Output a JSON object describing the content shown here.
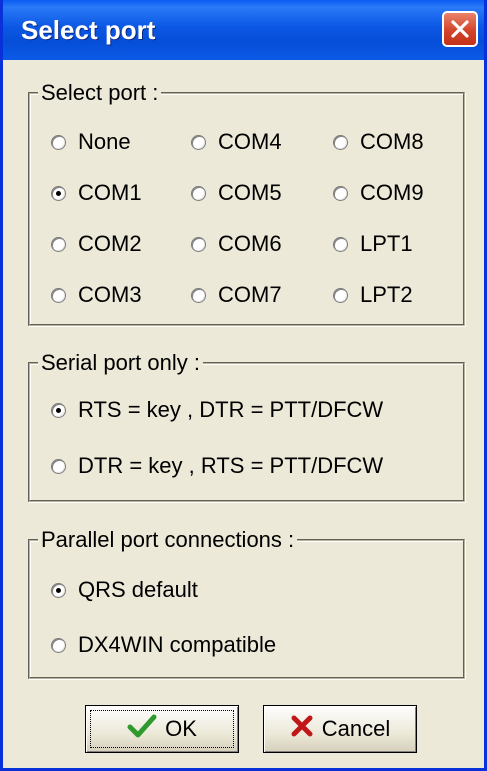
{
  "window": {
    "title": "Select port"
  },
  "port_group": {
    "legend": "Select port :",
    "options": [
      "None",
      "COM1",
      "COM2",
      "COM3",
      "COM4",
      "COM5",
      "COM6",
      "COM7",
      "COM8",
      "COM9",
      "LPT1",
      "LPT2"
    ],
    "selected": "COM1"
  },
  "serial_group": {
    "legend": "Serial port only :",
    "options": [
      "RTS = key , DTR = PTT/DFCW",
      "DTR = key , RTS = PTT/DFCW"
    ],
    "selected": "RTS = key , DTR = PTT/DFCW"
  },
  "parallel_group": {
    "legend": "Parallel port connections  :",
    "options": [
      "QRS default",
      "DX4WIN compatible"
    ],
    "selected": "QRS default"
  },
  "buttons": {
    "ok_label": "OK",
    "cancel_label": "Cancel"
  },
  "colors": {
    "titlebar": "#0a5ae6",
    "close": "#d4442a",
    "face": "#ece9d8",
    "ok_check": "#2e9a2e",
    "cancel_x": "#c01818"
  }
}
